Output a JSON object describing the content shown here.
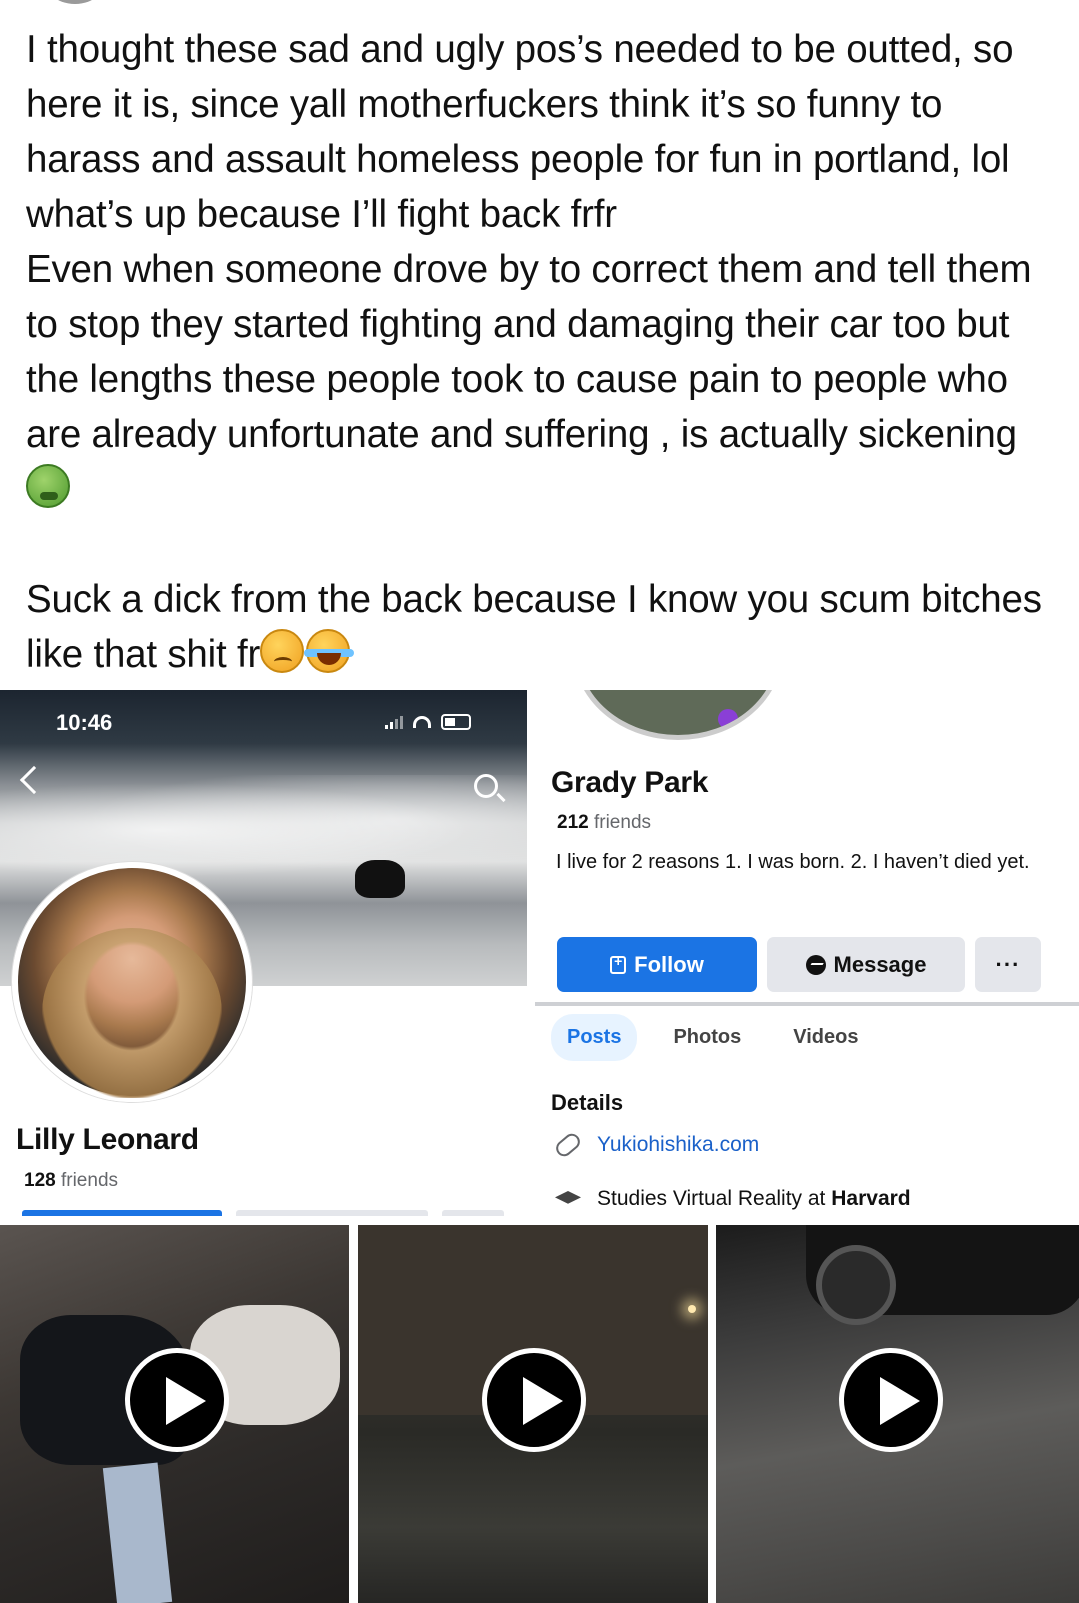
{
  "post": {
    "paragraph1": "I thought these sad and ugly pos’s needed to be outted, so here it is, since yall motherfuckers think it’s so funny to harass and assault homeless people for fun in portland, lol what’s up because I’ll fight back frfr",
    "paragraph2": "Even when someone drove by to correct them and tell them to stop they started fighting and damaging their car too but the lengths these people took to cause pain to people who are already unfortunate and suffering , is actually sickening",
    "paragraph3": "Suck a dick from the back because I know you scum bitches like that shit fr",
    "emoji_sick": "nauseated-face-emoji",
    "emoji_woozy": "woozy-face-emoji",
    "emoji_laugh": "tears-of-joy-emoji"
  },
  "left_profile": {
    "status_time": "10:46",
    "name": "Lilly Leonard",
    "friends_count": "128",
    "friends_label": "friends"
  },
  "right_profile": {
    "name": "Grady Park",
    "friends_count": "212",
    "friends_label": "friends",
    "bio": "I live for 2 reasons 1. I was born.  2. I haven’t died yet.",
    "follow_label": "Follow",
    "message_label": "Message",
    "more_label": "···",
    "tabs": [
      "Posts",
      "Photos",
      "Videos"
    ],
    "details_heading": "Details",
    "website": "Yukiohishika.com",
    "education_prefix": "Studies Virtual Reality at",
    "education_school": "Harvard",
    "accent_color": "#1b74e4"
  },
  "videos": [
    {
      "icon": "play-icon"
    },
    {
      "icon": "play-icon"
    },
    {
      "icon": "play-icon"
    }
  ]
}
